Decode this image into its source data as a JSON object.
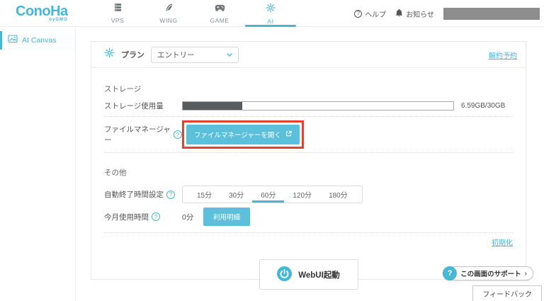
{
  "colors": {
    "accent": "#47b7d6",
    "button_cyan": "#5cc0da",
    "annotation_red": "#e6402e",
    "progress_fill": "#575c5f",
    "redacted_gray": "#8d8d8d"
  },
  "header": {
    "logo_text": "ConoHa",
    "logo_sub": "byGMO",
    "nav": [
      {
        "label": "VPS",
        "icon": "server-icon",
        "active": false
      },
      {
        "label": "WING",
        "icon": "wing-icon",
        "active": false
      },
      {
        "label": "GAME",
        "icon": "gamepad-icon",
        "active": false
      },
      {
        "label": "AI",
        "icon": "ai-icon",
        "active": true
      }
    ],
    "help_label": "ヘルプ",
    "news_label": "お知らせ"
  },
  "sidebar": {
    "items": [
      {
        "label": "AI Canvas",
        "icon": "canvas-image-icon",
        "active": true
      }
    ]
  },
  "main": {
    "plan": {
      "label": "プラン",
      "selected_value": "エントリー",
      "cancel_link": "解約予約"
    },
    "storage": {
      "section_title": "ストレージ",
      "usage_label": "ストレージ使用量",
      "usage_value": "6.59GB/30GB",
      "usage_percent": 22,
      "file_manager_label": "ファイルマネージャー",
      "file_manager_button": "ファイルマネージャーを開く"
    },
    "others": {
      "section_title": "その他",
      "auto_stop_label": "自動終了時間設定",
      "auto_stop_options": [
        "15分",
        "30分",
        "60分",
        "120分",
        "180分"
      ],
      "auto_stop_selected": "60分",
      "usage_time_label": "今月使用時間",
      "usage_time_value": "0分",
      "usage_detail_button": "利用明細",
      "init_link": "初期化"
    },
    "webui_button": "WebUI起動"
  },
  "footer": {
    "support_button": "この画面のサポート",
    "feedback_button": "フィードバック"
  }
}
